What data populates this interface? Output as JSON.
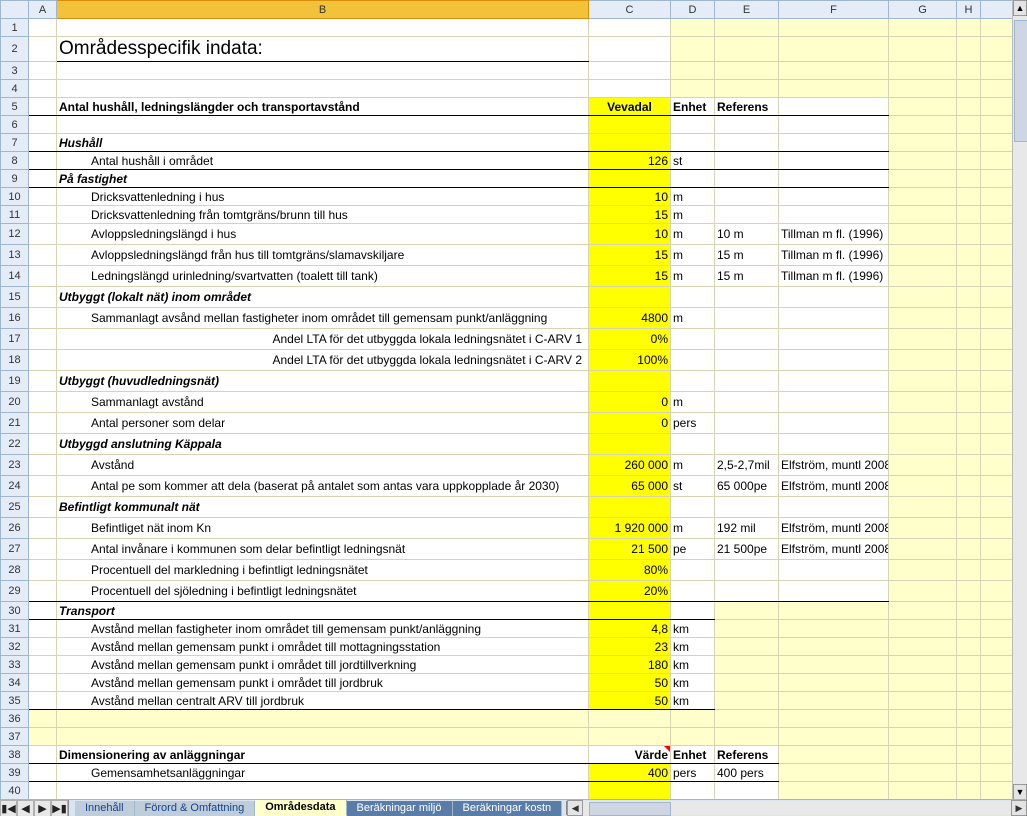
{
  "columns": [
    "A",
    "B",
    "C",
    "D",
    "E",
    "F",
    "G",
    "H"
  ],
  "title": "Områdesspecifik indata:",
  "hdr1": {
    "label": "Antal hushåll, ledningslängder och transportavstånd",
    "c": "Vevadal",
    "d": "Enhet",
    "e": "Referens"
  },
  "sec_hushall": "Hushåll",
  "r8": {
    "b": "Antal hushåll i området",
    "c": "126",
    "d": "st"
  },
  "sec_pa": "På fastighet",
  "r10": {
    "b": "Dricksvattenledning i hus",
    "c": "10",
    "d": "m"
  },
  "r11": {
    "b": "Dricksvattenledning från tomtgräns/brunn till hus",
    "c": "15",
    "d": "m"
  },
  "r12": {
    "b": "Avloppsledningslängd i hus",
    "c": "10",
    "d": "m",
    "e": "10 m",
    "f": "Tillman m fl. (1996)"
  },
  "r13": {
    "b": "Avloppsledningslängd från hus till tomtgräns/slamavskiljare",
    "c": "15",
    "d": "m",
    "e": "15 m",
    "f": "Tillman m fl. (1996)"
  },
  "r14": {
    "b": "Ledningslängd urinledning/svartvatten (toalett till tank)",
    "c": "15",
    "d": "m",
    "e": "15 m",
    "f": "Tillman m fl. (1996)"
  },
  "sec_utb_lok": "Utbyggt (lokalt nät) inom området",
  "r16": {
    "b": "Sammanlagt avsånd mellan fastigheter inom området till gemensam punkt/anläggning",
    "c": "4800",
    "d": "m"
  },
  "r17": {
    "b": "Andel LTA för det utbyggda lokala ledningsnätet i C-ARV 1",
    "c": "0%"
  },
  "r18": {
    "b": "Andel LTA för det utbyggda lokala ledningsnätet i C-ARV 2",
    "c": "100%"
  },
  "sec_utb_huv": "Utbyggt (huvudledningsnät)",
  "r20": {
    "b": "Sammanlagt avstånd",
    "c": "0",
    "d": "m"
  },
  "r21": {
    "b": "Antal personer som delar",
    "c": "0",
    "d": "pers"
  },
  "sec_kappala": "Utbyggd anslutning Käppala",
  "r23": {
    "b": "Avstånd",
    "c": "260 000",
    "d": "m",
    "e": "2,5-2,7mil",
    "f": "Elfström, muntl 2008"
  },
  "r24": {
    "b": "Antal pe som kommer att dela (baserat på antalet som antas vara uppkopplade år 2030)",
    "c": "65 000",
    "d": "st",
    "e": "65 000pe",
    "f": "Elfström, muntl 2008"
  },
  "sec_bef": "Befintligt kommunalt nät",
  "r26": {
    "b": "Befintliget nät inom Kn",
    "c": "1 920 000",
    "d": "m",
    "e": "192 mil",
    "f": "Elfström, muntl 2008"
  },
  "r27": {
    "b": "Antal invånare i kommunen som delar befintligt ledningsnät",
    "c": "21 500",
    "d": "pe",
    "e": "21 500pe",
    "f": "Elfström, muntl 2008"
  },
  "r28": {
    "b": "Procentuell del markledning i befintligt ledningsnätet",
    "c": "80%"
  },
  "r29": {
    "b": "Procentuell del sjöledning i befintligt ledningsnätet",
    "c": "20%"
  },
  "sec_transport": "Transport",
  "r31": {
    "b": "Avstånd mellan fastigheter inom området till gemensam punkt/anläggning",
    "c": "4,8",
    "d": "km"
  },
  "r32": {
    "b": "Avstånd mellan gemensam punkt i området till mottagningsstation",
    "c": "23",
    "d": "km"
  },
  "r33": {
    "b": "Avstånd mellan gemensam punkt i området till jordtillverkning",
    "c": "180",
    "d": "km"
  },
  "r34": {
    "b": "Avstånd mellan gemensam punkt i området till jordbruk",
    "c": "50",
    "d": "km"
  },
  "r35": {
    "b": "Avstånd mellan centralt ARV till jordbruk",
    "c": "50",
    "d": "km"
  },
  "hdr2": {
    "b": "Dimensionering av anläggningar",
    "c": "Värde",
    "d": "Enhet",
    "e": "Referens"
  },
  "r39": {
    "b": "Gemensamhetsanläggningar",
    "c": "400",
    "d": "pers",
    "e": "400 pers"
  },
  "tabs": {
    "innehall": "Innehåll",
    "forord": "Förord & Omfattning",
    "omrade": "Områdesdata",
    "miljo": "Beräkningar miljö",
    "kostn": "Beräkningar kostn"
  }
}
